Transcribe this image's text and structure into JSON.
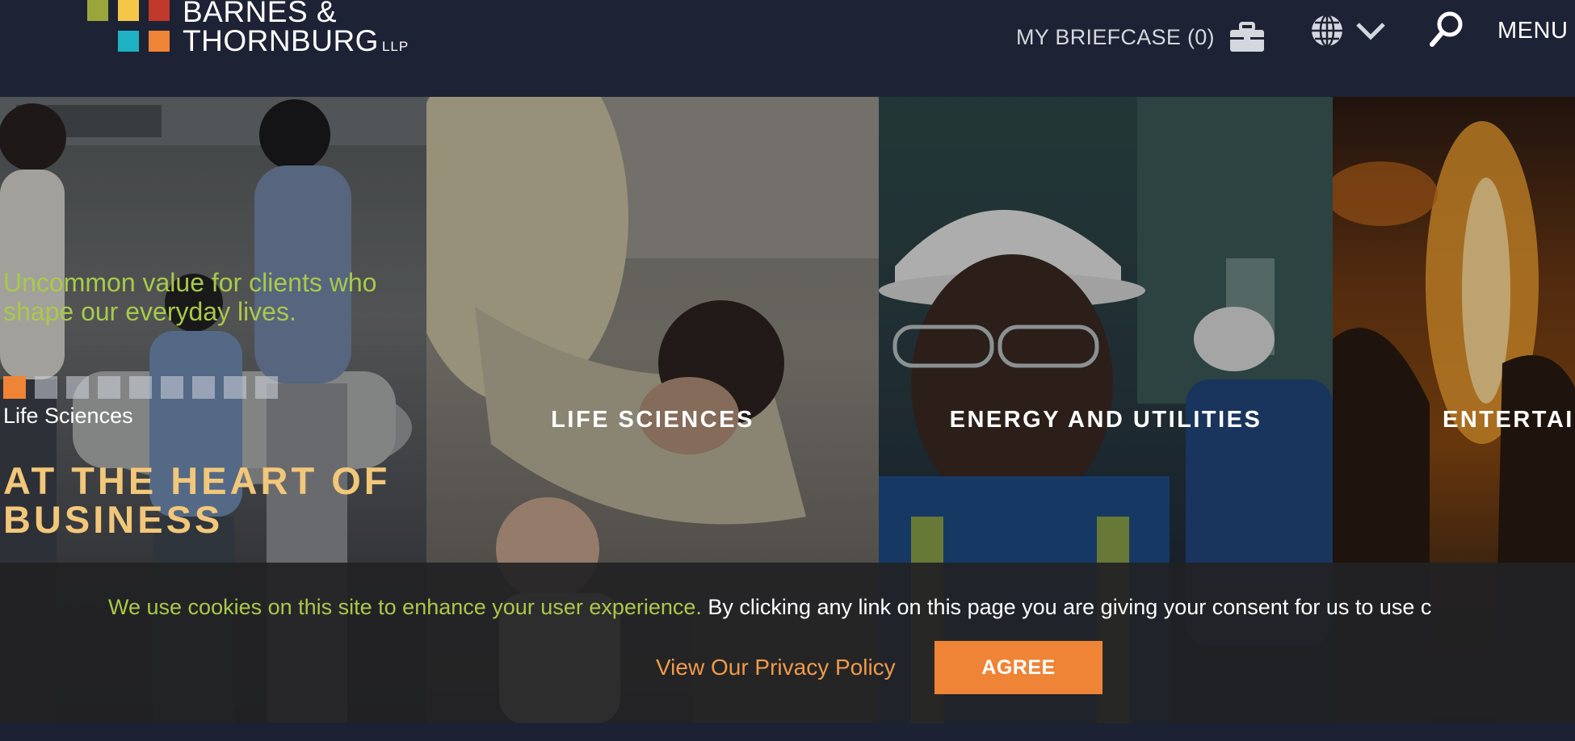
{
  "logo": {
    "line1": "BARNES &",
    "line2": "THORNBURG",
    "suffix": "LLP",
    "square_colors": [
      "#9aa63a",
      "#f4c74a",
      "#c0392b",
      "#1eb1c4",
      "#ef8436"
    ]
  },
  "header": {
    "briefcase_label": "MY BRIEFCASE (0)",
    "briefcase_icon": "briefcase-icon",
    "language_icon": "globe-icon",
    "language_chevron": "chevron-down-icon",
    "search_icon": "search-icon",
    "menu_label": "MENU"
  },
  "hero": {
    "tagline": "Uncommon value for clients who shape our everyday lives.",
    "slide_label": "Life Sciences",
    "headline": "AT THE HEART OF BUSINESS",
    "slide_count": 9,
    "active_slide": 1
  },
  "panels": [
    {
      "title": "LIFE SCIENCES"
    },
    {
      "title": "ENERGY AND UTILITIES"
    },
    {
      "title": "ENTERTAI"
    }
  ],
  "cookie": {
    "highlight": "We use cookies on this site to enhance your user experience.",
    "text": " By clicking any link on this page you are giving your consent for us to use c",
    "privacy_link": "View Our Privacy Policy",
    "agree_label": "AGREE"
  },
  "colors": {
    "navy": "#1d2234",
    "accent_green": "#a9c94a",
    "accent_orange": "#ef8436",
    "headline_gold": "#f2c77a"
  }
}
